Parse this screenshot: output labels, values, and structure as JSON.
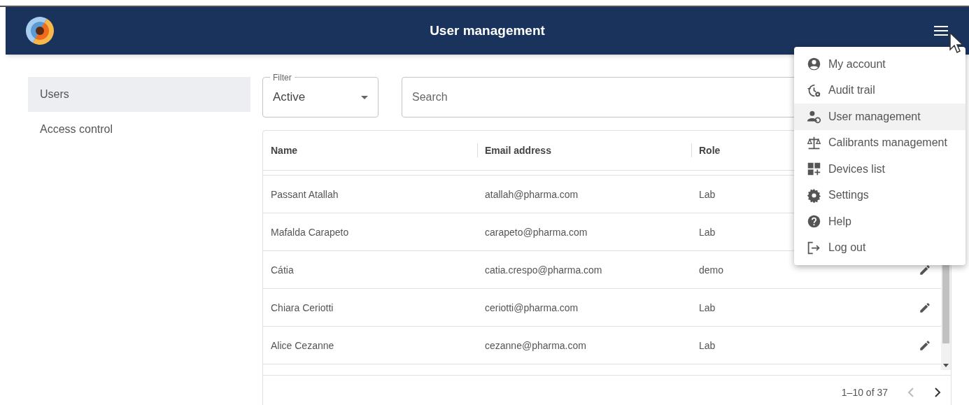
{
  "header": {
    "title": "User management"
  },
  "sidebar": {
    "items": [
      {
        "label": "Users",
        "selected": true
      },
      {
        "label": "Access control",
        "selected": false
      }
    ]
  },
  "filter": {
    "label": "Filter",
    "value": "Active"
  },
  "search": {
    "placeholder": "Search"
  },
  "table": {
    "columns": [
      "Name",
      "Email address",
      "Role"
    ],
    "rows": [
      {
        "name": "Passant Atallah",
        "email": "atallah@pharma.com",
        "role": "Lab",
        "edit_visible": false
      },
      {
        "name": "Mafalda Carapeto",
        "email": "carapeto@pharma.com",
        "role": "Lab",
        "edit_visible": false
      },
      {
        "name": "Cátia",
        "email": "catia.crespo@pharma.com",
        "role": "demo",
        "edit_visible": true
      },
      {
        "name": "Chiara Ceriotti",
        "email": "ceriotti@pharma.com",
        "role": "Lab",
        "edit_visible": true
      },
      {
        "name": "Alice Cezanne",
        "email": "cezanne@pharma.com",
        "role": "Lab",
        "edit_visible": true
      }
    ],
    "pagination": "1–10 of 37"
  },
  "menu": {
    "items": [
      {
        "kind": "account",
        "label": "My account",
        "selected": false
      },
      {
        "kind": "audit",
        "label": "Audit trail",
        "selected": false
      },
      {
        "kind": "users",
        "label": "User management",
        "selected": true
      },
      {
        "kind": "scale",
        "label": "Calibrants management",
        "selected": false
      },
      {
        "kind": "devices",
        "label": "Devices list",
        "selected": false
      },
      {
        "kind": "settings",
        "label": "Settings",
        "selected": false
      },
      {
        "kind": "help",
        "label": "Help",
        "selected": false
      },
      {
        "kind": "logout",
        "label": "Log out",
        "selected": false
      }
    ]
  }
}
